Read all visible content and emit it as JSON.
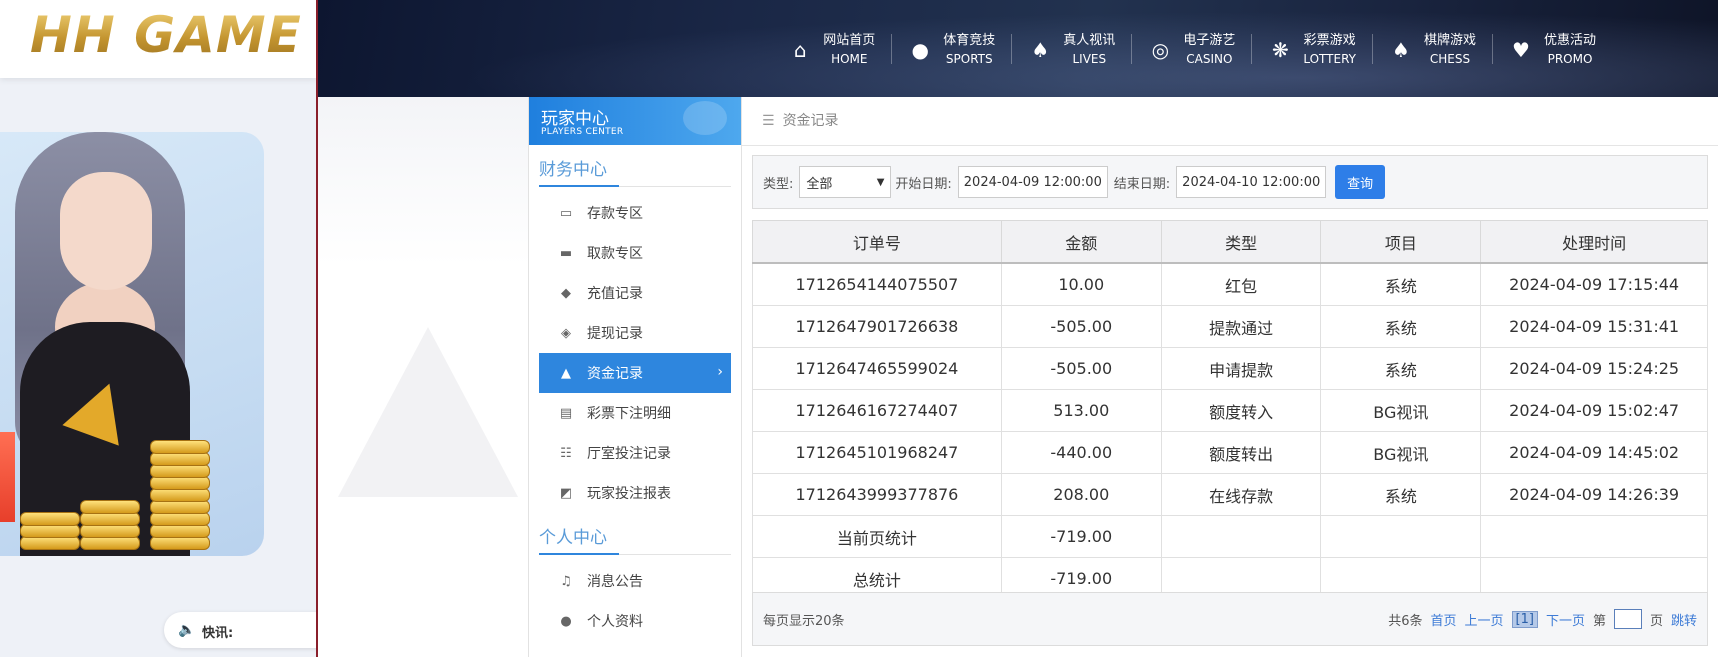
{
  "logo": {
    "text": "HH GAME"
  },
  "news": {
    "label": "快讯:"
  },
  "nav": [
    {
      "icon": "home-icon",
      "glyph": "⌂",
      "cn": "网站首页",
      "en": "HOME"
    },
    {
      "icon": "basketball-icon",
      "glyph": "●",
      "cn": "体育竞技",
      "en": "SPORTS"
    },
    {
      "icon": "cards-icon",
      "glyph": "♠",
      "cn": "真人视讯",
      "en": "LIVES"
    },
    {
      "icon": "slot-icon",
      "glyph": "◎",
      "cn": "电子游艺",
      "en": "CASINO"
    },
    {
      "icon": "lottery-balls-icon",
      "glyph": "❋",
      "cn": "彩票游戏",
      "en": "LOTTERY"
    },
    {
      "icon": "spade-icon",
      "glyph": "♠",
      "cn": "棋牌游戏",
      "en": "CHESS"
    },
    {
      "icon": "gift-icon",
      "glyph": "♥",
      "cn": "优惠活动",
      "en": "PROMO"
    }
  ],
  "players_center": {
    "cn": "玩家中心",
    "en": "PLAYERS CENTER"
  },
  "sidebar": {
    "finance_title": "财务中心",
    "finance_items": [
      {
        "label": "存款专区",
        "icon": "card-icon",
        "glyph": "▭"
      },
      {
        "label": "取款专区",
        "icon": "cash-hand-icon",
        "glyph": "▬"
      },
      {
        "label": "充值记录",
        "icon": "money-bag-icon",
        "glyph": "◆"
      },
      {
        "label": "提现记录",
        "icon": "wallet-icon",
        "glyph": "◈"
      },
      {
        "label": "资金记录",
        "icon": "bank-icon",
        "glyph": "▲",
        "active": true
      },
      {
        "label": "彩票下注明细",
        "icon": "list-icon",
        "glyph": "▤"
      },
      {
        "label": "厅室投注记录",
        "icon": "checklist-icon",
        "glyph": "☷"
      },
      {
        "label": "玩家投注报表",
        "icon": "chart-icon",
        "glyph": "◩"
      }
    ],
    "personal_title": "个人中心",
    "personal_items": [
      {
        "label": "消息公告",
        "icon": "bell-icon",
        "glyph": "♫"
      },
      {
        "label": "个人资料",
        "icon": "user-icon",
        "glyph": "●"
      }
    ]
  },
  "breadcrumb": {
    "icon": "menu-icon",
    "text": "资金记录"
  },
  "filter": {
    "type_label": "类型:",
    "type_value": "全部",
    "start_label": "开始日期:",
    "start_value": "2024-04-09 12:00:00",
    "end_label": "结束日期:",
    "end_value": "2024-04-10 12:00:00",
    "query_button": "查询"
  },
  "table": {
    "headers": [
      "订单号",
      "金额",
      "类型",
      "项目",
      "处理时间"
    ],
    "rows": [
      [
        "1712654144075507",
        "10.00",
        "红包",
        "系统",
        "2024-04-09 17:15:44"
      ],
      [
        "1712647901726638",
        "-505.00",
        "提款通过",
        "系统",
        "2024-04-09 15:31:41"
      ],
      [
        "1712647465599024",
        "-505.00",
        "申请提款",
        "系统",
        "2024-04-09 15:24:25"
      ],
      [
        "1712646167274407",
        "513.00",
        "额度转入",
        "BG视讯",
        "2024-04-09 15:02:47"
      ],
      [
        "1712645101968247",
        "-440.00",
        "额度转出",
        "BG视讯",
        "2024-04-09 14:45:02"
      ],
      [
        "1712643999377876",
        "208.00",
        "在线存款",
        "系统",
        "2024-04-09 14:26:39"
      ]
    ],
    "summary": [
      {
        "label": "当前页统计",
        "value": "-719.00"
      },
      {
        "label": "总统计",
        "value": "-719.00"
      }
    ]
  },
  "pager": {
    "per_page": "每页显示20条",
    "total": "共6条",
    "first": "首页",
    "prev": "上一页",
    "current": "[1]",
    "next": "下一页",
    "page_prefix": "第",
    "page_suffix": "页",
    "jump": "跳转"
  }
}
